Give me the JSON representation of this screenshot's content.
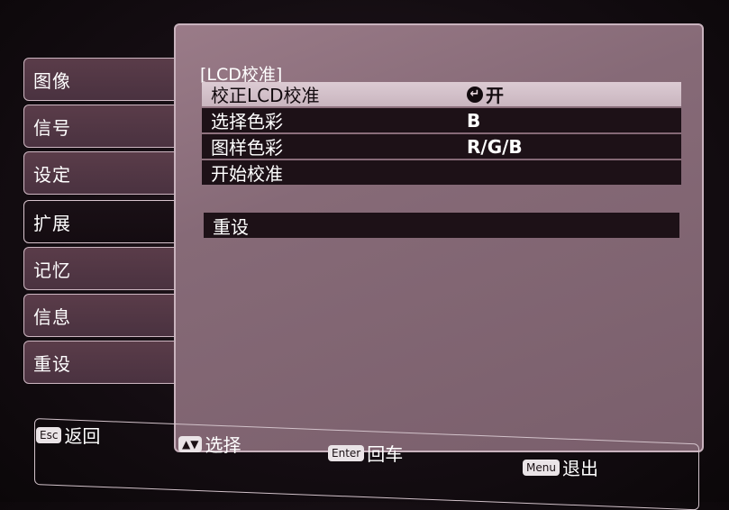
{
  "sidebar": {
    "items": [
      {
        "label": "图像"
      },
      {
        "label": "信号"
      },
      {
        "label": "设定"
      },
      {
        "label": "扩展",
        "active": true
      },
      {
        "label": "记忆"
      },
      {
        "label": "信息"
      },
      {
        "label": "重设"
      }
    ]
  },
  "panel": {
    "title": "[LCD校准]",
    "rows": [
      {
        "label": "校正LCD校准",
        "value": "开",
        "icon": "enter-icon"
      },
      {
        "label": "选择色彩",
        "value": "B"
      },
      {
        "label": "图样色彩",
        "value": "R/G/B"
      },
      {
        "label": "开始校准",
        "value": ""
      }
    ],
    "reset_label": "重设"
  },
  "help": {
    "esc_key": "Esc",
    "esc_label": "返回",
    "nav_key": "▲▼",
    "nav_label": "选择",
    "enter_key": "Enter",
    "enter_label": "回车",
    "menu_key": "Menu",
    "menu_label": "退出"
  },
  "colors": {
    "panel": "#866a77",
    "row_bg": "#1d1117",
    "highlight": "#dccbd3"
  }
}
